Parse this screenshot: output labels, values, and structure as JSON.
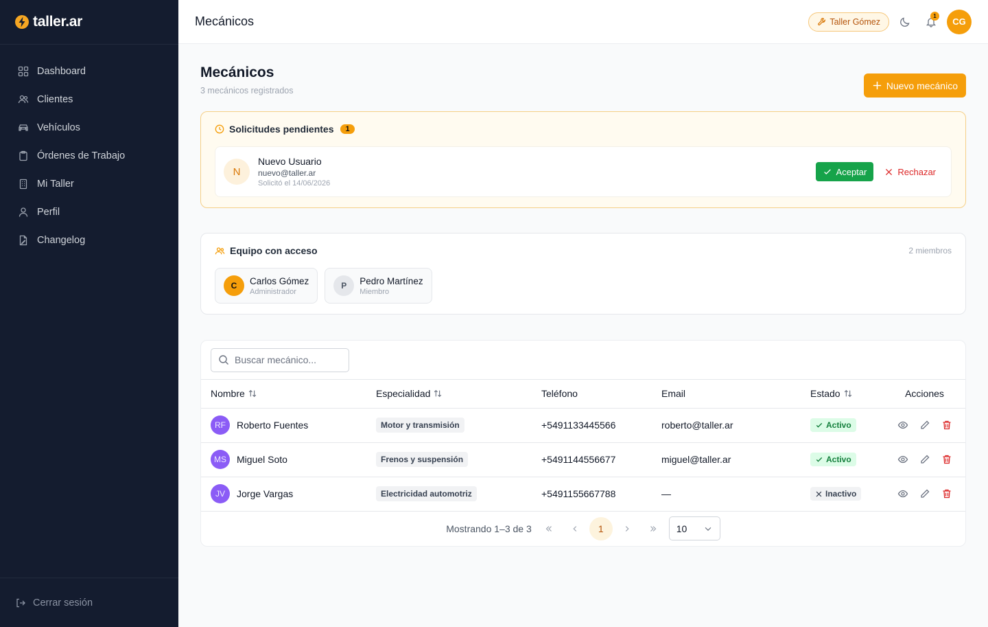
{
  "app": {
    "brand": "taller.ar"
  },
  "sidebar": {
    "items": [
      {
        "label": "Dashboard",
        "icon": "grid-icon"
      },
      {
        "label": "Clientes",
        "icon": "users-icon"
      },
      {
        "label": "Vehículos",
        "icon": "car-icon"
      },
      {
        "label": "Órdenes de Trabajo",
        "icon": "clipboard-icon"
      },
      {
        "label": "Mi Taller",
        "icon": "building-icon"
      },
      {
        "label": "Perfil",
        "icon": "user-icon"
      },
      {
        "label": "Changelog",
        "icon": "document-icon"
      }
    ],
    "logout": "Cerrar sesión"
  },
  "topbar": {
    "title": "Mecánicos",
    "workshop": "Taller Gómez",
    "notifications_count": "1",
    "user_initials": "CG"
  },
  "page": {
    "title": "Mecánicos",
    "subtitle": "3 mecánicos registrados",
    "new_button": "Nuevo mecánico"
  },
  "pending": {
    "title": "Solicitudes pendientes",
    "count": "1",
    "request": {
      "initial": "N",
      "name": "Nuevo Usuario",
      "email": "nuevo@taller.ar",
      "date": "Solicitó el 14/06/2026",
      "accept": "Aceptar",
      "reject": "Rechazar"
    }
  },
  "team": {
    "title": "Equipo con acceso",
    "count": "2 miembros",
    "members": [
      {
        "initial": "C",
        "name": "Carlos Gómez",
        "role": "Administrador"
      },
      {
        "initial": "P",
        "name": "Pedro Martínez",
        "role": "Miembro"
      }
    ]
  },
  "table": {
    "search_placeholder": "Buscar mecánico...",
    "headers": {
      "name": "Nombre",
      "specialty": "Especialidad",
      "phone": "Teléfono",
      "email": "Email",
      "status": "Estado",
      "actions": "Acciones"
    },
    "rows": [
      {
        "initials": "RF",
        "name": "Roberto Fuentes",
        "specialty": "Motor y transmisión",
        "phone": "+5491133445566",
        "email": "roberto@taller.ar",
        "status": "Activo"
      },
      {
        "initials": "MS",
        "name": "Miguel Soto",
        "specialty": "Frenos y suspensión",
        "phone": "+5491144556677",
        "email": "miguel@taller.ar",
        "status": "Activo"
      },
      {
        "initials": "JV",
        "name": "Jorge Vargas",
        "specialty": "Electricidad automotriz",
        "phone": "+5491155667788",
        "email": "—",
        "status": "Inactivo"
      }
    ]
  },
  "pagination": {
    "summary": "Mostrando 1–3 de 3",
    "current_page": "1",
    "page_size": "10"
  },
  "colors": {
    "accent": "#f59e0b",
    "sidebar_bg": "#141c2f",
    "success": "#16a34a",
    "danger": "#dc2626",
    "avatar_purple": "#8b5cf6"
  }
}
